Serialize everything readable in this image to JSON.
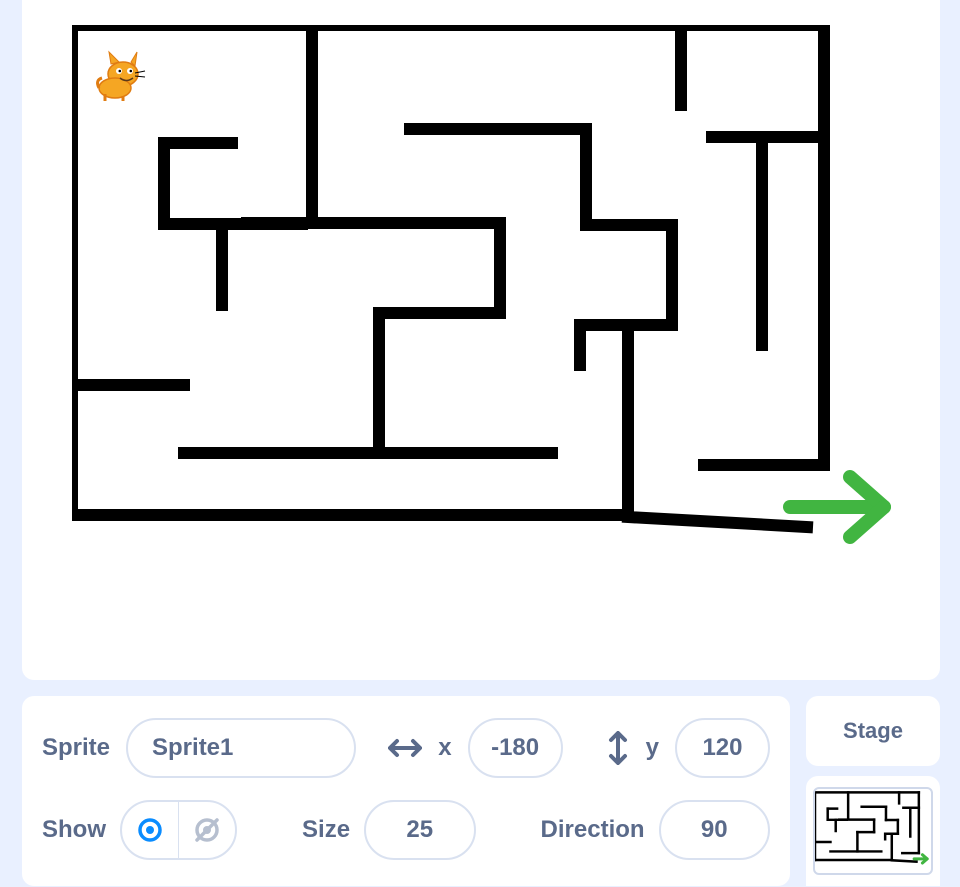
{
  "sprite": {
    "label": "Sprite",
    "name": "Sprite1",
    "x_label": "x",
    "x": "-180",
    "y_label": "y",
    "y": "120",
    "show_label": "Show",
    "size_label": "Size",
    "size": "25",
    "direction_label": "Direction",
    "direction": "90"
  },
  "stage": {
    "label": "Stage"
  },
  "icons": {
    "arrow_h": "arrow-horizontal-icon",
    "arrow_v": "arrow-vertical-icon",
    "eye_show": "eye-show-icon",
    "eye_hide": "eye-hide-icon",
    "exit_arrow": "arrow-right-icon"
  },
  "colors": {
    "text": "#5a6a8a",
    "accent_blue": "#0a8cff",
    "wall": "#000000",
    "exit": "#41b541",
    "cat_body": "#f5a623",
    "cat_stripe": "#e07c12"
  }
}
